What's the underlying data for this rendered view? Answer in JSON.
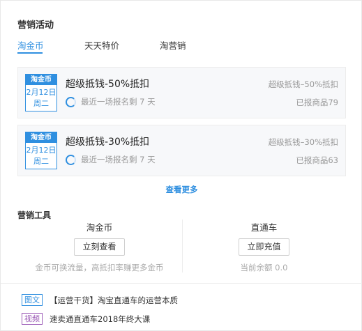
{
  "header": {
    "title": "营销活动"
  },
  "tabs": [
    {
      "label": "淘金币"
    },
    {
      "label": "天天特价"
    },
    {
      "label": "淘营销"
    }
  ],
  "activities": [
    {
      "badge": "淘金币",
      "date": "2月12日",
      "weekday": "周二",
      "title": "超级抵钱-50%抵扣",
      "countdown": "最近一场报名剩 7 天",
      "right_title": "超级抵钱–50%抵扣",
      "signed": "已报商品79"
    },
    {
      "badge": "淘金币",
      "date": "2月12日",
      "weekday": "周二",
      "title": "超级抵钱-30%抵扣",
      "countdown": "最近一场报名剩 7 天",
      "right_title": "超级抵钱–30%抵扣",
      "signed": "已报商品63"
    }
  ],
  "more_label": "查看更多",
  "tools": {
    "title": "营销工具",
    "left": {
      "name": "淘金币",
      "button": "立刻查看",
      "note": "金币可换流量，高抵扣率赚更多金币"
    },
    "right": {
      "name": "直通车",
      "button": "立即充值",
      "note": "当前余额 0.0"
    }
  },
  "news": [
    {
      "tag": "图文",
      "text": "【运营干货】淘宝直通车的运营本质"
    },
    {
      "tag": "视频",
      "text": "速卖通直通车2018年终大课"
    }
  ],
  "colors": {
    "accent": "#2f8fe0",
    "video_tag": "#9b59b6"
  }
}
